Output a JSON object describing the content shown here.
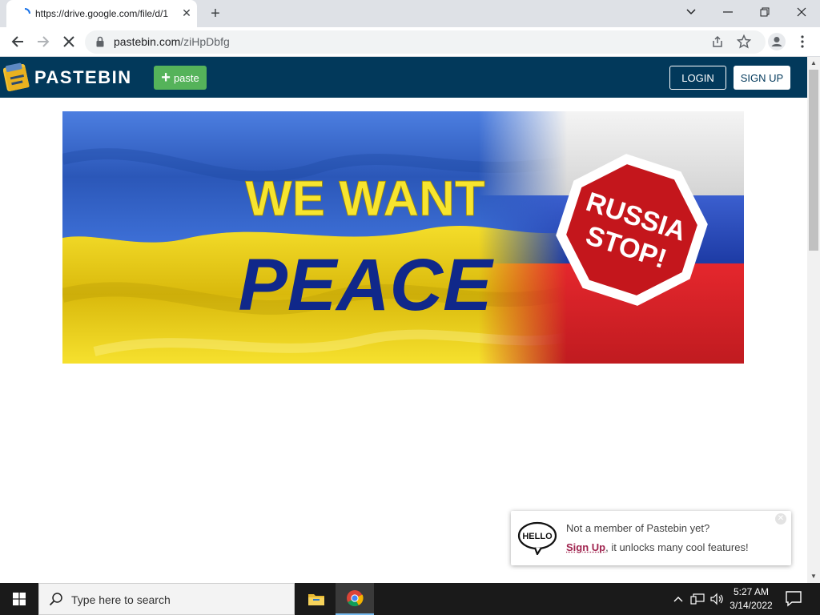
{
  "browser": {
    "tab": {
      "title": "https://drive.google.com/file/d/1",
      "close_glyph": "✕"
    },
    "new_tab_glyph": "+",
    "url_host": "pastebin.com",
    "url_path": "/ziHpDbfg",
    "icons": [
      "tab-search-icon",
      "minimize-icon",
      "maximize-icon",
      "close-icon",
      "back-icon",
      "forward-icon",
      "stop-loading-icon",
      "lock-icon",
      "share-icon",
      "star-icon",
      "profile-icon",
      "menu-icon"
    ]
  },
  "pastebin": {
    "brand": "PASTEBIN",
    "paste_button": "paste",
    "paste_plus": "+",
    "login": "LOGIN",
    "signup": "SIGN UP",
    "colors": {
      "header": "#02395b",
      "paste_green": "#55b35a",
      "signup_link": "#a0244f"
    }
  },
  "banner": {
    "line1": "WE WANT",
    "line2": "PEACE",
    "stop_line1": "RUSSIA",
    "stop_line2": "STOP!",
    "colors": {
      "ua_blue": "#2f5fc0",
      "ua_yellow": "#f0d21c",
      "ru_red": "#d8262a",
      "stop_red": "#c4161c",
      "text_yellow": "#f7e52f",
      "text_blue": "#10288a"
    }
  },
  "popup": {
    "icon_text": "HELLO",
    "line1": "Not a member of Pastebin yet?",
    "signup_link": "Sign Up",
    "line2_rest": ", it unlocks many cool features!",
    "close_glyph": "✕"
  },
  "taskbar": {
    "search_placeholder": "Type here to search",
    "time": "5:27 AM",
    "date": "3/14/2022",
    "tray_caret": "^"
  }
}
